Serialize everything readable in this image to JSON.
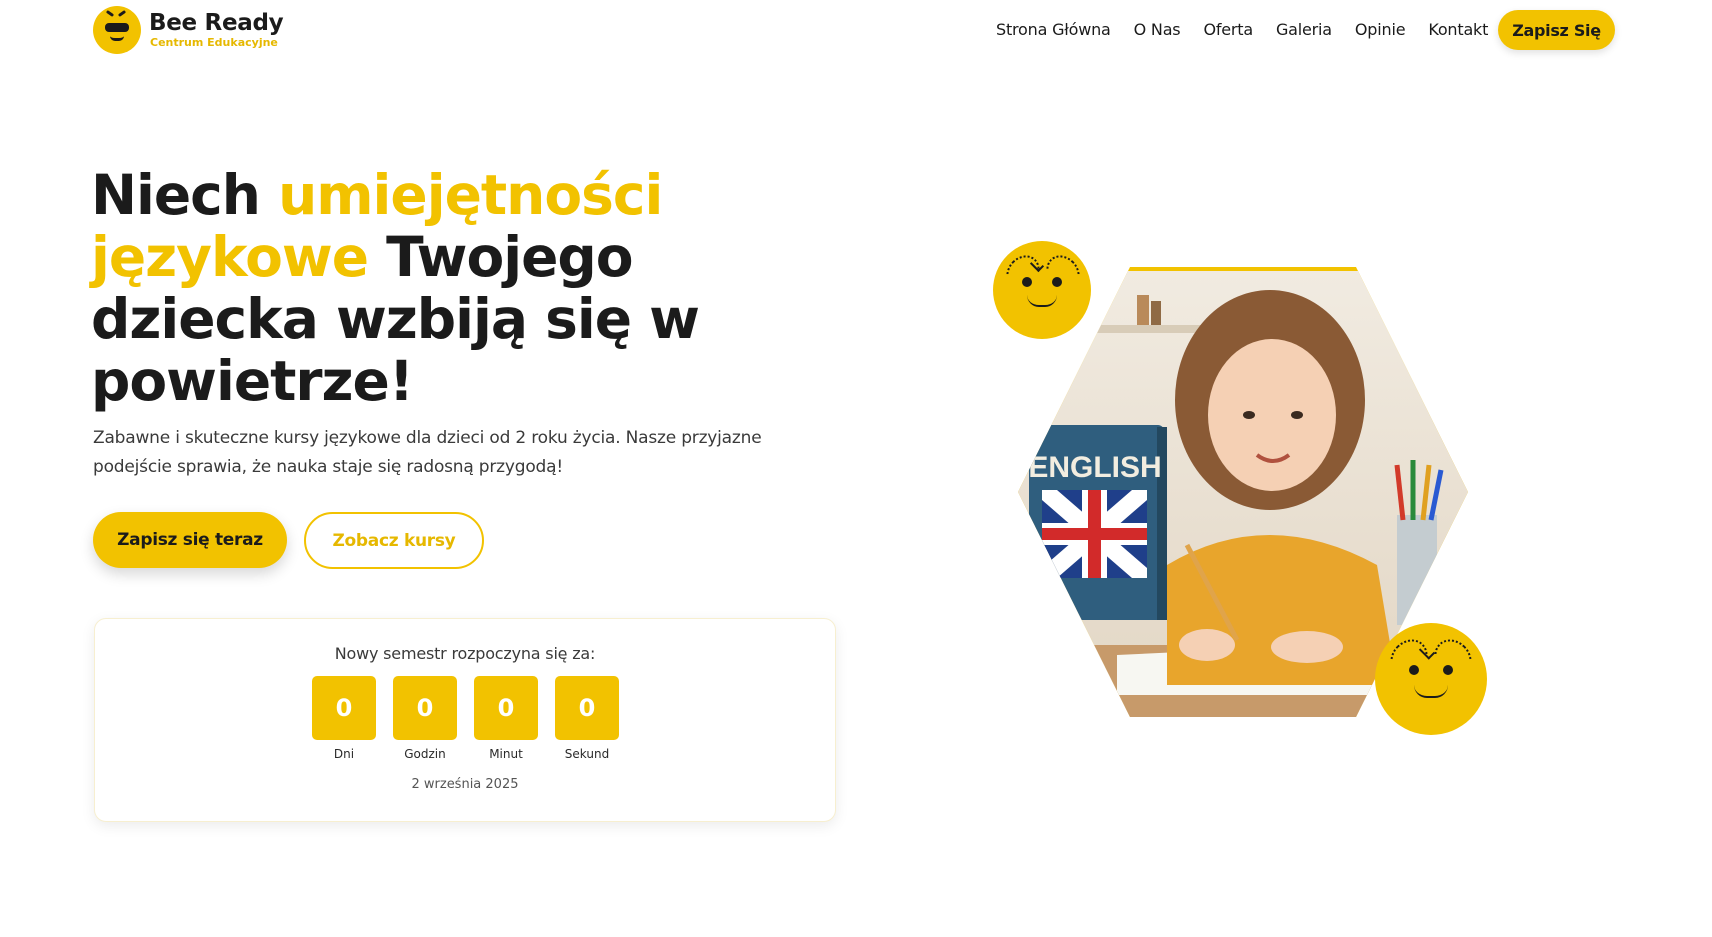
{
  "header": {
    "logo_title": "Bee Ready",
    "logo_subtitle": "Centrum Edukacyjne",
    "nav": [
      {
        "label": "Strona Główna"
      },
      {
        "label": "O Nas"
      },
      {
        "label": "Oferta"
      },
      {
        "label": "Galeria"
      },
      {
        "label": "Opinie"
      },
      {
        "label": "Kontakt"
      }
    ],
    "cta_label": "Zapisz Się"
  },
  "hero": {
    "title_part1": "Niech ",
    "title_highlight": "umiejętności językowe",
    "title_part2": " Twojego dziecka wzbiją się w powietrze!",
    "subtitle": "Zabawne i skuteczne kursy językowe dla dzieci od 2 roku życia. Nasze przyjazne podejście sprawia, że nauka staje się radosną przygodą!",
    "primary_button": "Zapisz się teraz",
    "secondary_button": "Zobacz kursy"
  },
  "countdown": {
    "title": "Nowy semestr rozpoczyna się za:",
    "units": [
      {
        "value": "0",
        "label": "Dni"
      },
      {
        "value": "0",
        "label": "Godzin"
      },
      {
        "value": "0",
        "label": "Minut"
      },
      {
        "value": "0",
        "label": "Sekund"
      }
    ],
    "date": "2 września 2025"
  },
  "image": {
    "book_text": "ENGLISH"
  },
  "colors": {
    "accent": "#f2c200",
    "text": "#1b1b1b"
  },
  "icons": [
    "bee-logo-icon",
    "smiley-bee-icon"
  ]
}
